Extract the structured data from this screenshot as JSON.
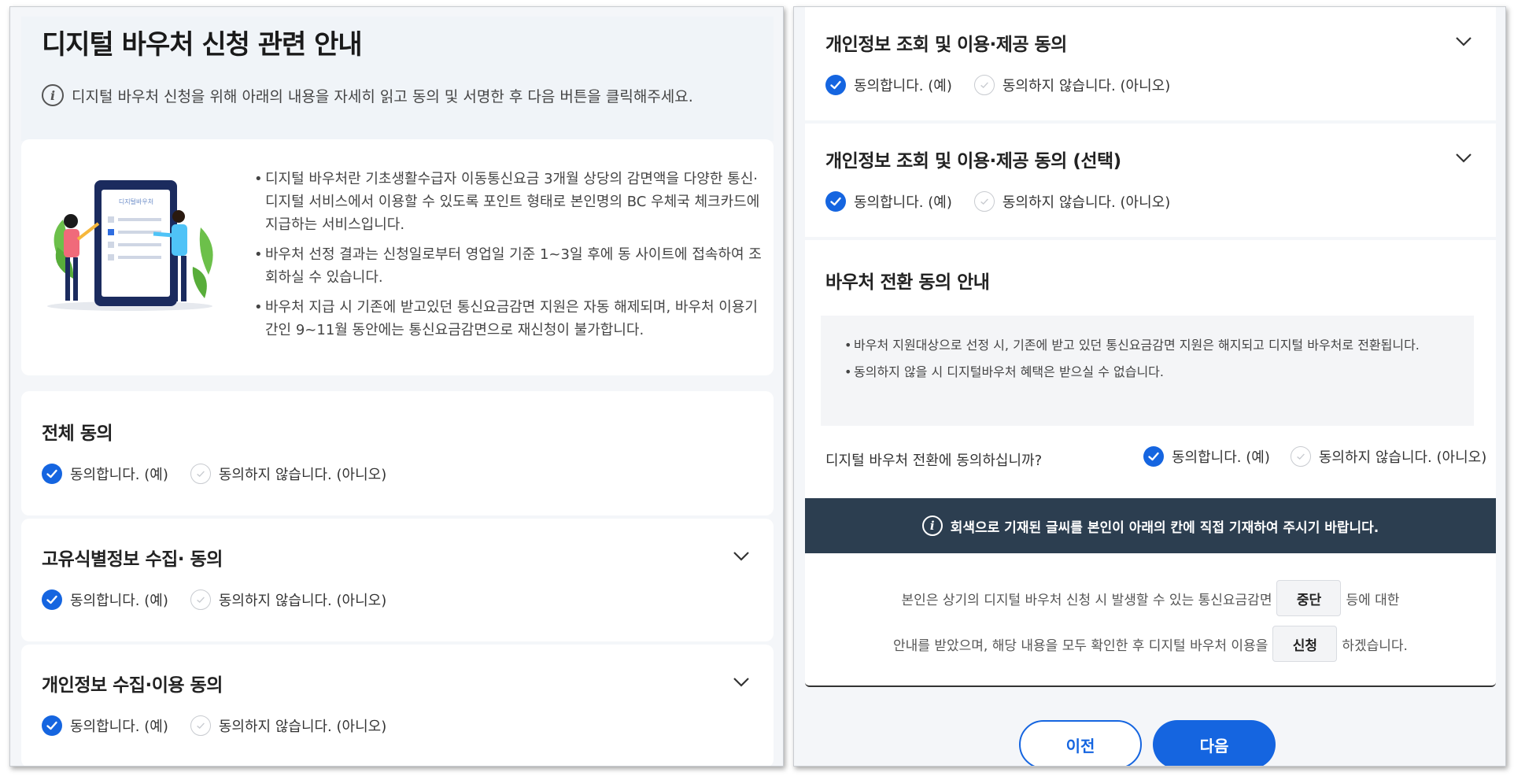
{
  "left_panel": {
    "title": "디지털 바우처 신청 관련 안내",
    "info_text": "디지털 바우처 신청을 위해 아래의 내용을 자세히 읽고 동의 및 서명한 후 다음 버튼을 클릭해주세요.",
    "illustration_caption": "디지털바우처",
    "bullets": [
      "디지털 바우처란 기초생활수급자 이동통신요금 3개월 상당의 감면액을 다양한 통신·디지털 서비스에서 이용할 수 있도록 포인트 형태로 본인명의 BC 우체국 체크카드에 지급하는 서비스입니다.",
      "바우처 선정 결과는 신청일로부터 영업일 기준 1~3일 후에 동 사이트에 접속하여 조회하실 수 있습니다.",
      "바우처 지급 시 기존에 받고있던 통신요금감면 지원은 자동 해제되며, 바우처 이용기간인 9~11월 동안에는 통신요금감면으로 재신청이 불가합니다."
    ],
    "consents": [
      {
        "title": "전체 동의",
        "yes": "동의합니다. (예)",
        "no": "동의하지 않습니다. (아니오)"
      },
      {
        "title": "고유식별정보 수집· 동의",
        "yes": "동의합니다. (예)",
        "no": "동의하지 않습니다. (아니오)"
      },
      {
        "title": "개인정보 수집·이용 동의",
        "yes": "동의합니다. (예)",
        "no": "동의하지 않습니다. (아니오)"
      }
    ]
  },
  "right_panel": {
    "consents": [
      {
        "title": "개인정보 조회 및 이용·제공 동의",
        "yes": "동의합니다. (예)",
        "no": "동의하지 않습니다. (아니오)"
      },
      {
        "title": "개인정보 조회 및 이용·제공 동의 (선택)",
        "yes": "동의합니다. (예)",
        "no": "동의하지 않습니다. (아니오)"
      }
    ],
    "voucher_section": {
      "title": "바우처 전환 동의 안내",
      "notices": [
        "바우처 지원대상으로 선정 시, 기존에 받고 있던 통신요금감면 지원은 해지되고 디지털 바우처로 전환됩니다.",
        "동의하지 않을 시 디지털바우처 혜택은 받으실 수 없습니다."
      ],
      "question": "디지털 바우처 전환에 동의하십니까?",
      "yes": "동의합니다. (예)",
      "no": "동의하지 않습니다. (아니오)"
    },
    "instruction": "회색으로 기재된 글씨를 본인이 아래의 칸에 직접 기재하여 주시기 바랍니다.",
    "sign": {
      "line1_pre": "본인은 상기의 디지털 바우처 신청 시 발생할 수 있는 통신요금감면",
      "box1": "중단",
      "line1_post": "등에 대한",
      "line2_pre": "안내를 받았으며, 해당 내용을 모두 확인한 후 디지털 바우처 이용을",
      "box2": "신청",
      "line2_post": "하겠습니다."
    },
    "buttons": {
      "prev": "이전",
      "next": "다음"
    }
  },
  "colors": {
    "accent": "#1565e0",
    "dark_bar": "#2c3e50",
    "panel_bg": "#f4f6f9"
  }
}
